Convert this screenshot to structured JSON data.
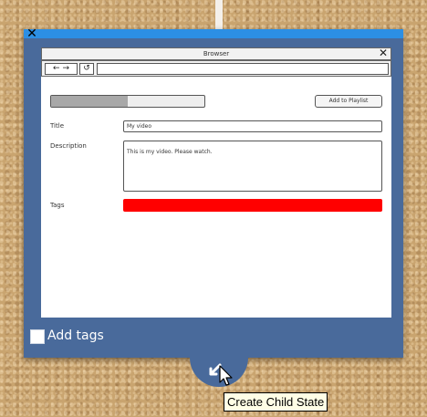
{
  "overlay": {
    "close_glyph": "✕",
    "add_tags_label": "Add tags",
    "add_tags_checked": false,
    "tooltip_text": "Create Child State",
    "accent_color": "#2c8fe4",
    "panel_color": "#496a9b"
  },
  "mockup": {
    "window_title": "Browser",
    "close_glyph": "✕",
    "back_glyph": "←",
    "forward_glyph": "→",
    "reload_glyph": "↺",
    "progress_fraction": 0.5,
    "button_label": "Add to Playlist",
    "title_label": "Title",
    "title_value": "My video",
    "description_label": "Description",
    "description_value": "This is my video. Please watch.",
    "tags_label": "Tags",
    "tags_bar_color": "#ff0000"
  }
}
